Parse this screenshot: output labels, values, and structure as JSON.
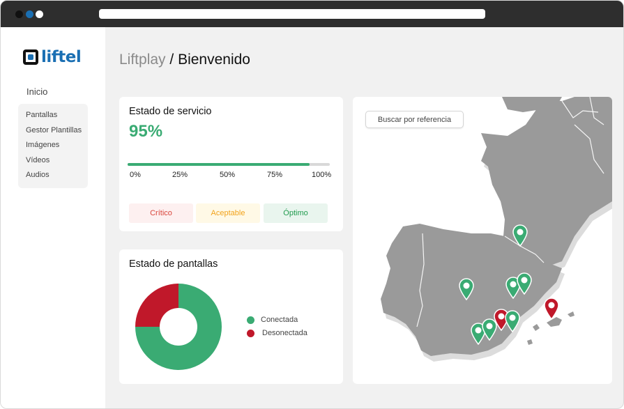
{
  "sidebar": {
    "logo_text": "liftel",
    "home_label": "Inicio",
    "items": [
      {
        "label": "Pantallas"
      },
      {
        "label": "Gestor Plantillas"
      },
      {
        "label": "Imágenes"
      },
      {
        "label": "Vídeos"
      },
      {
        "label": "Audios"
      }
    ]
  },
  "breadcrumb": {
    "parent": "Liftplay",
    "separator": "/",
    "current": "Bienvenido"
  },
  "service": {
    "title": "Estado de servicio",
    "percent_text": "95%",
    "progress": 0.9,
    "ticks": [
      "0%",
      "25%",
      "50%",
      "75%",
      "100%"
    ],
    "statuses": {
      "critical": "Crítico",
      "acceptable": "Aceptable",
      "optimal": "Óptimo"
    }
  },
  "screens": {
    "title": "Estado de pantallas",
    "legend": {
      "connected": "Conectada",
      "disconnected": "Desonectada"
    },
    "connected_fraction": 0.75,
    "disconnected_fraction": 0.25
  },
  "map": {
    "search_label": "Buscar por referencia",
    "pins": [
      {
        "icon": "map-pin-icon",
        "status": "connected"
      },
      {
        "icon": "map-pin-icon",
        "status": "connected"
      },
      {
        "icon": "map-pin-icon",
        "status": "connected"
      },
      {
        "icon": "map-pin-icon",
        "status": "connected"
      },
      {
        "icon": "map-pin-icon",
        "status": "disconnected"
      },
      {
        "icon": "map-pin-icon",
        "status": "connected"
      },
      {
        "icon": "map-pin-icon",
        "status": "connected"
      },
      {
        "icon": "map-pin-icon",
        "status": "connected"
      },
      {
        "icon": "map-pin-icon",
        "status": "disconnected"
      }
    ]
  },
  "colors": {
    "accent_blue": "#1a6fb3",
    "connected_green": "#3aab73",
    "disconnected_red": "#c0182a",
    "critical_red": "#d9453b",
    "acceptable_amber": "#f2a31b",
    "optimal_green": "#1f9a4d"
  }
}
